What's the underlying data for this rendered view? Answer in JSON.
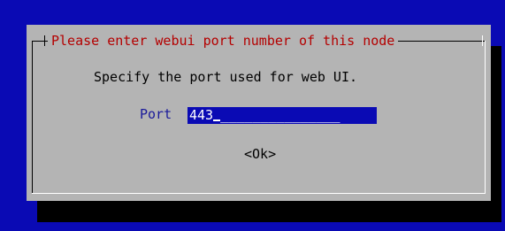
{
  "dialog": {
    "title": "Please enter webui port number of this node",
    "prompt": "Specify the port used for web UI.",
    "port_label": "Port",
    "port_value": "443",
    "port_fill": "_______________",
    "ok_label": "<Ok>"
  },
  "colors": {
    "background": "#0a0ab4",
    "dialog": "#b4b4b4",
    "title": "#b40000",
    "input": "#0a0ab4",
    "shadow": "#000000"
  }
}
